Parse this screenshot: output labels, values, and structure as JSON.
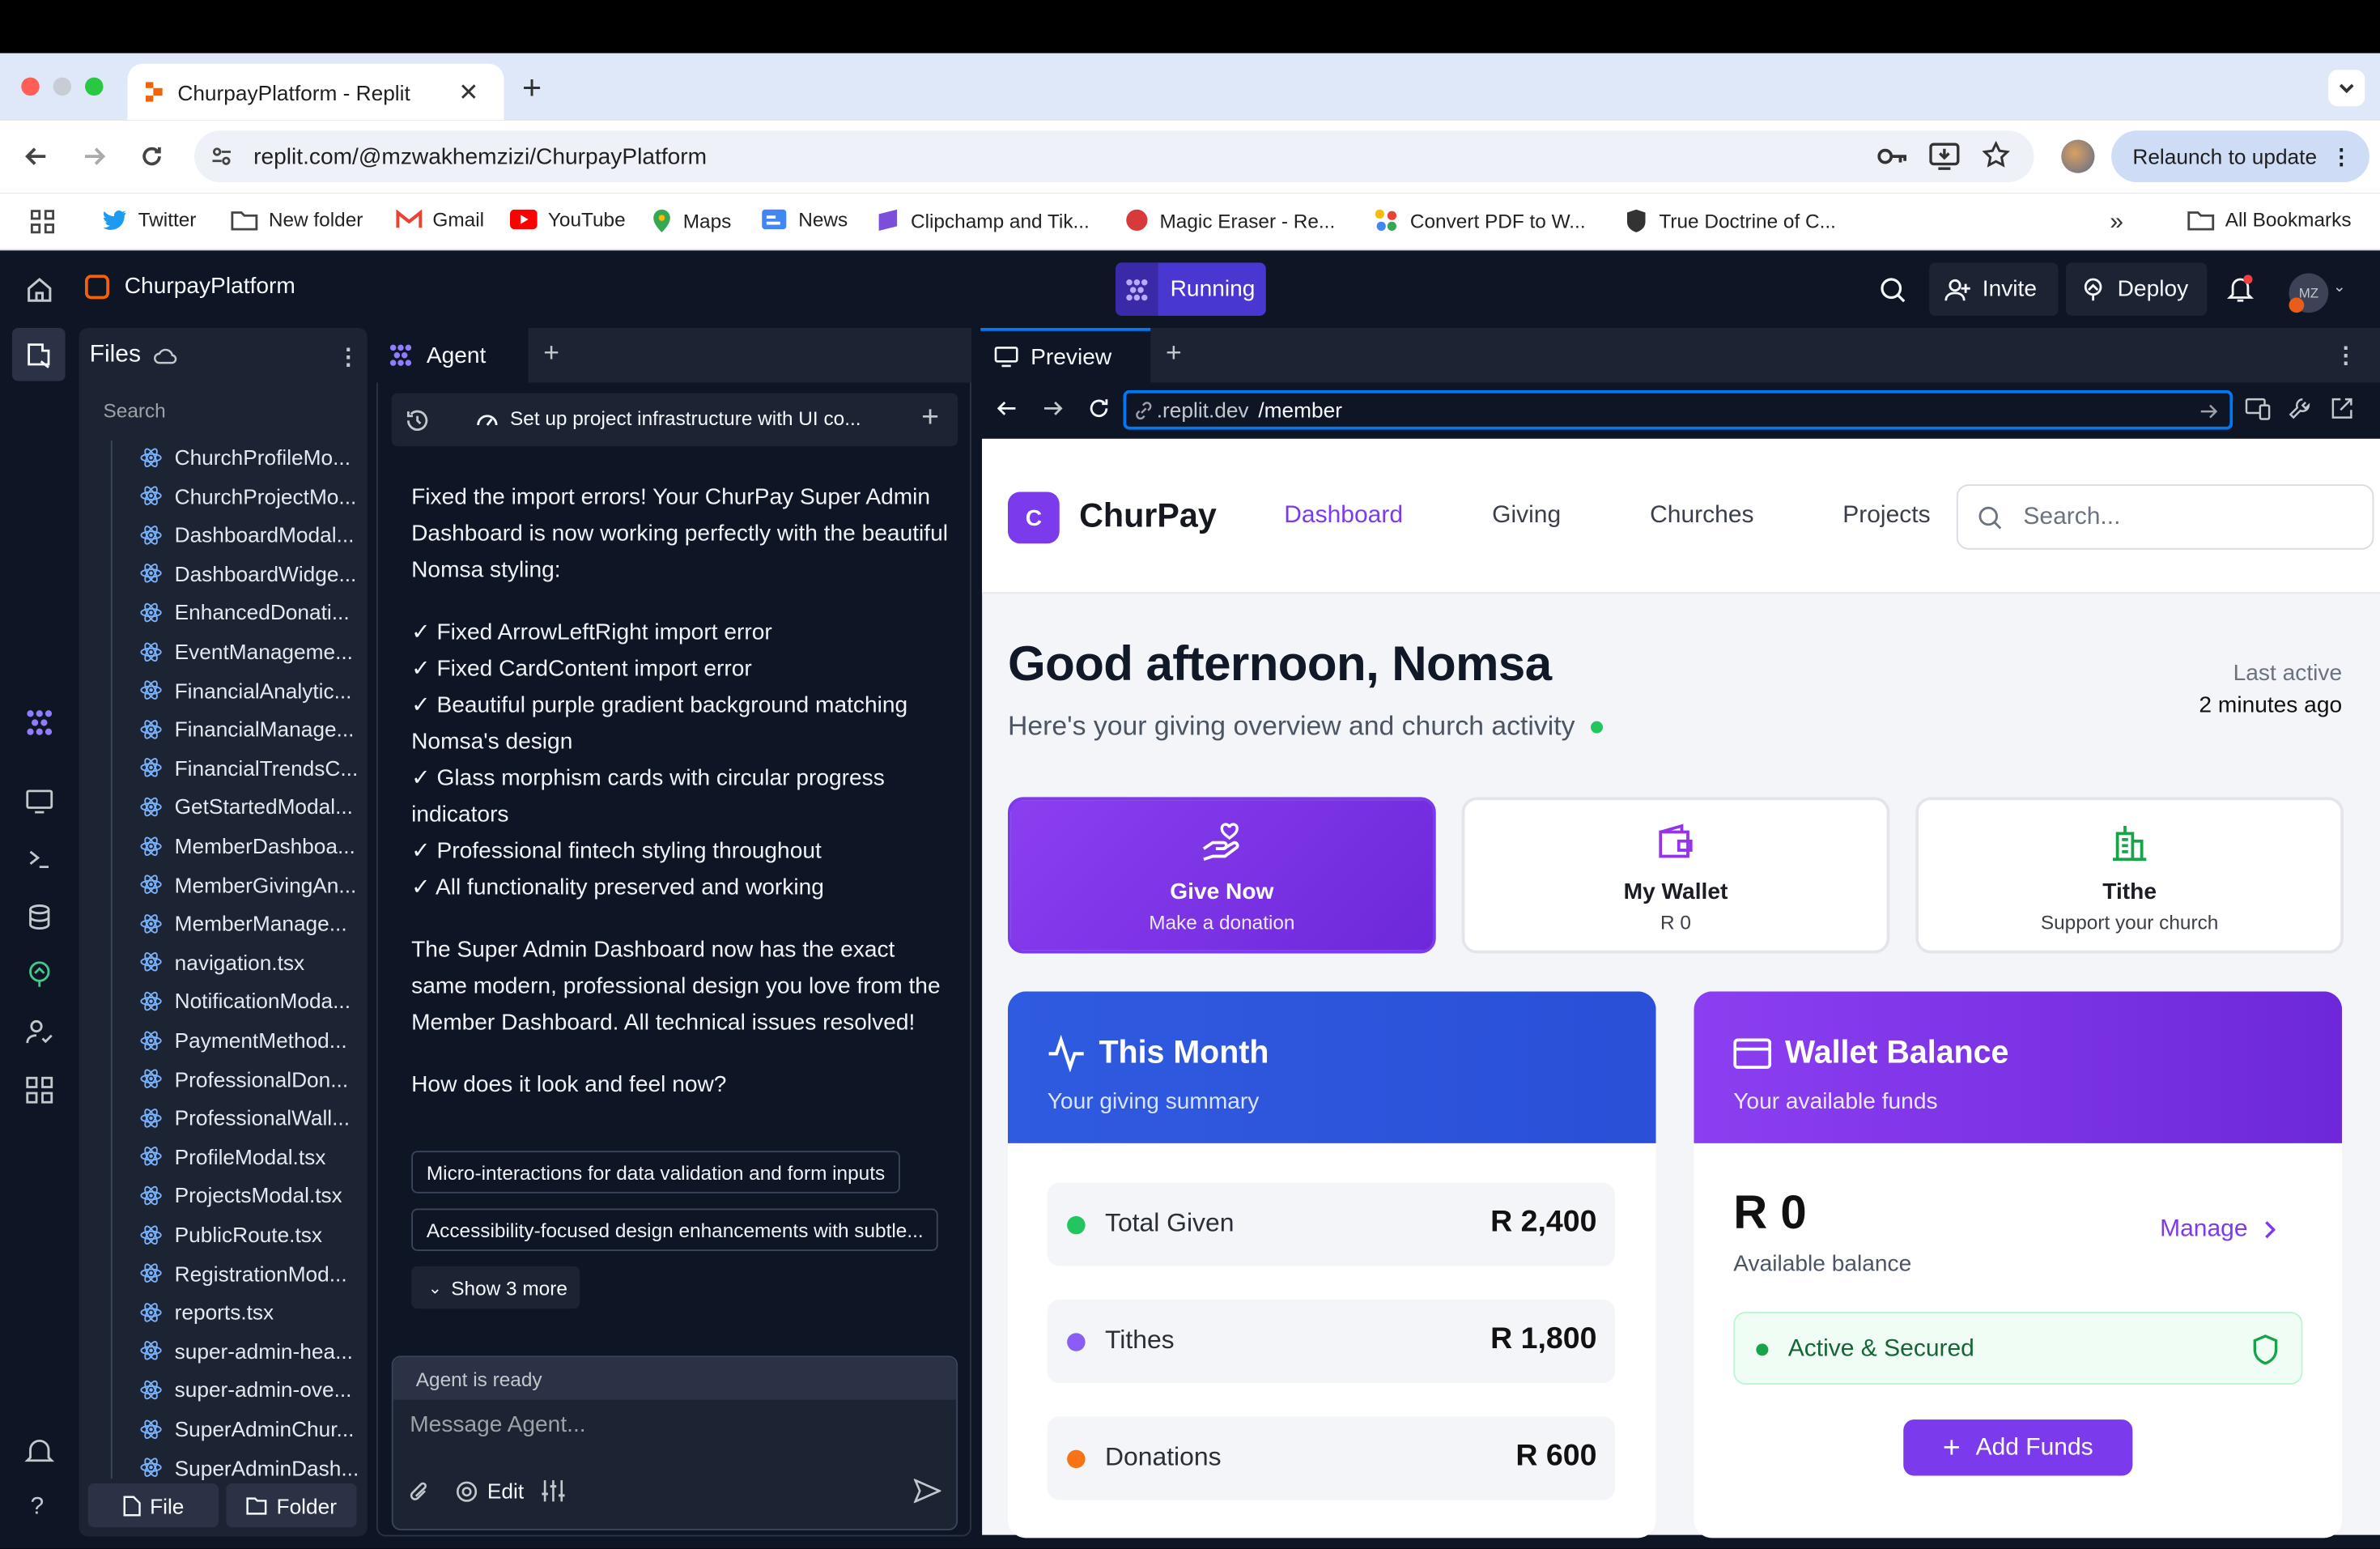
{
  "browser": {
    "tab_title": "ChurpayPlatform - Replit",
    "url": "replit.com/@mzwakhemzizi/ChurpayPlatform",
    "relaunch_label": "Relaunch to update",
    "bookmarks": [
      "Twitter",
      "New folder",
      "Gmail",
      "YouTube",
      "Maps",
      "News",
      "Clipchamp and Tik...",
      "Magic Eraser - Re...",
      "Convert PDF to W...",
      "True Doctrine of C..."
    ],
    "all_bookmarks": "All Bookmarks"
  },
  "replit": {
    "project_name": "ChurpayPlatform",
    "status": "Running",
    "invite": "Invite",
    "deploy": "Deploy",
    "avatar_initials": "MZ",
    "files": {
      "title": "Files",
      "search_placeholder": "Search",
      "items": [
        "ChurchProfileMo...",
        "ChurchProjectMo...",
        "DashboardModal...",
        "DashboardWidge...",
        "EnhancedDonati...",
        "EventManageme...",
        "FinancialAnalytic...",
        "FinancialManage...",
        "FinancialTrendsC...",
        "GetStartedModal...",
        "MemberDashboa...",
        "MemberGivingAn...",
        "MemberManage...",
        "navigation.tsx",
        "NotificationModa...",
        "PaymentMethod...",
        "ProfessionalDon...",
        "ProfessionalWall...",
        "ProfileModal.tsx",
        "ProjectsModal.tsx",
        "PublicRoute.tsx",
        "RegistrationMod...",
        "reports.tsx",
        "super-admin-hea...",
        "super-admin-ove...",
        "SuperAdminChur...",
        "SuperAdminDash..."
      ],
      "file_btn": "File",
      "folder_btn": "Folder"
    },
    "agent": {
      "tab": "Agent",
      "task": "Set up project infrastructure with UI co...",
      "intro": "Fixed the import errors! Your ChurPay Super Admin Dashboard is now working perfectly with the beautiful Nomsa styling:",
      "checks": [
        "✓ Fixed ArrowLeftRight import error",
        "✓ Fixed CardContent import error",
        "✓ Beautiful purple gradient background matching Nomsa's design",
        "✓ Glass morphism cards with circular progress indicators",
        "✓ Professional fintech styling throughout",
        "✓ All functionality preserved and working"
      ],
      "summary": "The Super Admin Dashboard now has the exact same modern, professional design you love from the Member Dashboard. All technical issues resolved!",
      "question": "How does it look and feel now?",
      "suggestions": [
        "Micro-interactions for data validation and form inputs",
        "Accessibility-focused design enhancements with subtle..."
      ],
      "show_more": "Show 3 more",
      "ready": "Agent is ready",
      "input_placeholder": "Message Agent...",
      "edit": "Edit"
    },
    "preview": {
      "tab": "Preview",
      "url_prefix": ".replit.dev",
      "url_path": "/member"
    }
  },
  "churpay": {
    "logo_letter": "C",
    "brand": "ChurPay",
    "nav": [
      "Dashboard",
      "Giving",
      "Churches",
      "Projects"
    ],
    "search_placeholder": "Search...",
    "greeting": "Good afternoon, Nomsa",
    "subtitle": "Here's your giving overview and church activity",
    "last_active_label": "Last active",
    "last_active_value": "2 minutes ago",
    "actions": [
      {
        "title": "Give Now",
        "subtitle": "Make a donation"
      },
      {
        "title": "My Wallet",
        "subtitle": "R 0"
      },
      {
        "title": "Tithe",
        "subtitle": "Support your church"
      }
    ],
    "this_month": {
      "title": "This Month",
      "subtitle": "Your giving summary",
      "rows": [
        {
          "label": "Total Given",
          "value": "R 2,400",
          "color": "#22c55e"
        },
        {
          "label": "Tithes",
          "value": "R 1,800",
          "color": "#8b5cf6"
        },
        {
          "label": "Donations",
          "value": "R 600",
          "color": "#f97316"
        }
      ]
    },
    "wallet": {
      "title": "Wallet Balance",
      "subtitle": "Your available funds",
      "amount": "R 0",
      "amount_label": "Available balance",
      "manage": "Manage",
      "status": "Active & Secured",
      "add_funds": "Add Funds"
    }
  },
  "colors": {
    "purple": "#7c3aed",
    "blue": "#2f5be0",
    "replit_bg": "#0e1525",
    "replit_panel": "#1c2333"
  }
}
